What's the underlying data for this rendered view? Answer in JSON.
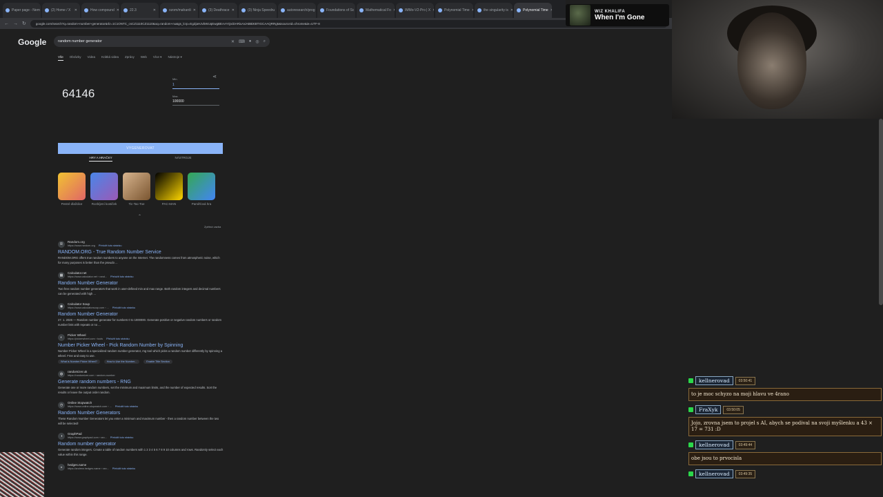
{
  "browser": {
    "tabs": [
      {
        "label": "Paper page - Nem",
        "active": false
      },
      {
        "label": "(2) Home / X",
        "active": false
      },
      {
        "label": "How compound",
        "active": false
      },
      {
        "label": "22.3",
        "active": false
      },
      {
        "label": "ozom/mahardi",
        "active": false
      },
      {
        "label": "(3) Deathrace",
        "active": false
      },
      {
        "label": "(3) Ninja Speedru",
        "active": false
      },
      {
        "label": "autoresearch/prog",
        "active": false
      },
      {
        "label": "Foundations of Sc",
        "active": false
      },
      {
        "label": "Mathematical Fo",
        "active": false
      },
      {
        "label": "IMMo-V2-Pro | X",
        "active": false
      },
      {
        "label": "Polynomial Time",
        "active": false
      },
      {
        "label": "the singularity is",
        "active": false
      },
      {
        "label": "Polynomial Time",
        "active": true
      }
    ],
    "address": "google.com/search?q=random+number+generator&rlz=1C1ONTC_csCZ1110CZ1110&oq=random+nu&gs_lcrp=EgZjaHJvbWUqEwgBEAAYQxiDARixAxiABBiKBTIGCAAQRRg5&sourceid=chrome&ie=UTF-8"
  },
  "song": {
    "artist": "WIZ KHALIFA",
    "title": "When I'm Gone"
  },
  "google": {
    "logo": "Google",
    "query": "random number generator",
    "nav": [
      "Vše",
      "Obrázky",
      "Videa",
      "Krátká videa",
      "Zprávy",
      "Web",
      "Více ▾",
      "Nástroje ▾"
    ],
    "rng": {
      "result": "64146",
      "min_label": "Min.",
      "min_value": "1",
      "max_label": "Max.",
      "max_value": "100000",
      "generate": "VYGENEROVAT",
      "subtabs": [
        "HRY A HRAČKY",
        "NÁSTROJE"
      ],
      "games": [
        {
          "name": "Pestré dlaždice",
          "color1": "#f1c232",
          "color2": "#e06666"
        },
        {
          "name": "Rozbíjení kostiček",
          "color1": "#4a86e8",
          "color2": "#9b59b6"
        },
        {
          "name": "Tic-Tac-Toe",
          "color1": "#d7b48e",
          "color2": "#7a5530"
        },
        {
          "name": "PAC-MAN",
          "color1": "#000000",
          "color2": "#ffd700"
        },
        {
          "name": "Paměťová hra",
          "color1": "#34a853",
          "color2": "#4285f4"
        }
      ],
      "feedback": "Zpětná vazba"
    },
    "results": [
      {
        "icon": "R",
        "site": "Random.org",
        "url": "https://www.random.org",
        "translate": "Přeložit tuto stránku",
        "title": "RANDOM.ORG - True Random Number Service",
        "snippet": "RANDOM.ORG offers true random numbers to anyone on the Internet. The randomness comes from atmospheric noise, which for many purposes is better than the pseudo ..."
      },
      {
        "icon": "▦",
        "site": "Calculator.net",
        "url": "https://www.calculator.net › rand...",
        "translate": "Přeložit tuto stránku",
        "title": "Random Number Generator",
        "snippet": "Two free random number generators that work in user-defined min and max range. Both random integers and decimal numbers can be generated with high ..."
      },
      {
        "icon": "◉",
        "site": "Calculator Soup",
        "url": "https://www.calculatorsoup.com › ...",
        "translate": "Přeložit tuto stránku",
        "title": "Random Number Generator",
        "snippet": "27. 1. 2026 — Random number generator for numbers 0 to 1000000. Generate positive or negative random numbers or random number lists with repeats or no ..."
      },
      {
        "icon": "◐",
        "site": "Picker Wheel",
        "url": "https://pickerwheel.com › tools",
        "translate": "Přeložit tuto stránku",
        "title": "Number Picker Wheel - Pick Random Number by Spinning",
        "snippet": "Number Picker Wheel is a specialized random number generator, rng tool which picks a random number differently by spinning a wheel. Free and easy to use.",
        "links": [
          "What is Number Picker Wheel?",
          "How to Use the Number...",
          "Enable Title Section"
        ]
      },
      {
        "icon": "◍",
        "site": "randomizer.uk",
        "url": "https://randomizer.com › random-number",
        "translate": "",
        "title": "Generate random numbers - RNG",
        "snippet": "Generate one or more random numbers, set the minimum and maximum limits, and the number of expected results. Sort the results or leave the output order random."
      },
      {
        "icon": "◷",
        "site": "Online Stopwatch",
        "url": "https://www.online-stopwatch.com › ...",
        "translate": "Přeložit tuto stránku",
        "title": "Random Number Generators",
        "snippet": "These Random Number Generators let you enter a minimum and maximum number - then a random number between the two will be selected!"
      },
      {
        "icon": "◑",
        "site": "GraphPad",
        "url": "https://www.graphpad.com › ran...",
        "translate": "Přeložit tuto stránku",
        "title": "Random number generator",
        "snippet": "Generate random integers. Create a table of random numbers with 1 2 3 4 5 6 7 8 9 10 columns and rows. Randomly select each value within this range."
      },
      {
        "icon": "◒",
        "site": "hedges.name",
        "url": "https://andrew.hedges.name › ran...",
        "translate": "Přeložit tuto stránku",
        "title": "",
        "snippet": ""
      }
    ]
  },
  "chat": [
    {
      "user": "kellnerovad",
      "time": "03:50:41",
      "text": "to je moc schyzo na moji hlavu ve 4rano"
    },
    {
      "user": "FraXyk",
      "time": "03:50:05",
      "text": "Jojo, zrovna jsem to projel s AI, abych se podival na svoji myšlenku a 43 × 17 = 731 :D"
    },
    {
      "user": "kellnerovad",
      "time": "03:49:44",
      "text": "obe jsou to prvocisla"
    },
    {
      "user": "kellnerovad",
      "time": "03:49:35",
      "text": ""
    }
  ],
  "colors": {
    "accent": "#8ab4f8",
    "chat_badge": "#2bd74b",
    "page_bg": "#1f1f1f"
  }
}
